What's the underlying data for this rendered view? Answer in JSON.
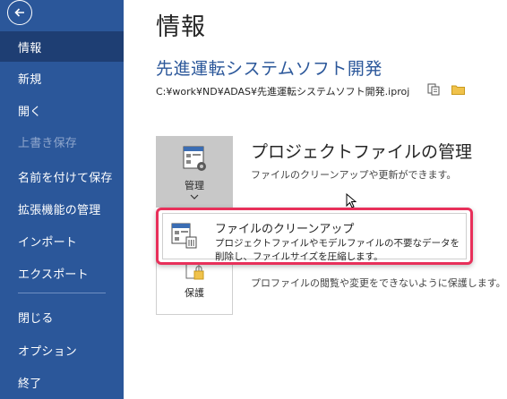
{
  "sidebar": {
    "items": [
      {
        "label": "情報",
        "state": "active"
      },
      {
        "label": "新規",
        "state": "normal"
      },
      {
        "label": "開く",
        "state": "normal"
      },
      {
        "label": "上書き保存",
        "state": "disabled"
      },
      {
        "label": "名前を付けて保存",
        "state": "normal"
      },
      {
        "label": "拡張機能の管理",
        "state": "normal"
      },
      {
        "label": "インポート",
        "state": "normal"
      },
      {
        "label": "エクスポート",
        "state": "normal"
      },
      {
        "label": "閉じる",
        "state": "normal"
      },
      {
        "label": "オプション",
        "state": "normal"
      },
      {
        "label": "終了",
        "state": "normal"
      }
    ],
    "back_icon": "back-arrow-icon"
  },
  "main": {
    "page_title": "情報",
    "document_title": "先進運転システムソフト開発",
    "document_path": "C:¥work¥ND¥ADAS¥先進運転システムソフト開発.iproj",
    "manage": {
      "tile_label": "管理",
      "heading": "プロジェクトファイルの管理",
      "description": "ファイルのクリーンアップや更新ができます。"
    },
    "protect": {
      "tile_label": "保護",
      "description": "プロファイルの閲覧や変更をできないように保護します。"
    },
    "dropdown": {
      "title": "ファイルのクリーンアップ",
      "description": "プロジェクトファイルやモデルファイルの不要なデータを削除し、ファイルサイズを圧縮します。"
    }
  },
  "colors": {
    "sidebar_bg": "#2b579a",
    "sidebar_active": "#1e3e73",
    "accent_text": "#2b579a",
    "highlight_border": "#e8305a"
  }
}
